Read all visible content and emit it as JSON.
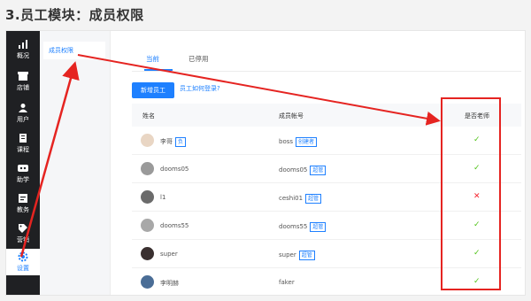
{
  "heading": "3.员工模块：成员权限",
  "rail": [
    {
      "icon": "overview-icon",
      "label": "概况"
    },
    {
      "icon": "store-icon",
      "label": "店铺"
    },
    {
      "icon": "user-icon",
      "label": "用户"
    },
    {
      "icon": "course-icon",
      "label": "课程"
    },
    {
      "icon": "assistant-icon",
      "label": "助学"
    },
    {
      "icon": "academic-icon",
      "label": "教务"
    },
    {
      "icon": "marketing-icon",
      "label": "营销"
    },
    {
      "icon": "settings-icon",
      "label": "设置"
    }
  ],
  "submenu": {
    "item": "成员权限"
  },
  "tabs": [
    "当前",
    "已停用"
  ],
  "toolbar": {
    "add_button": "新增员工",
    "help_link": "员工如何登录?"
  },
  "table": {
    "headers": [
      "姓名",
      "成员帐号",
      "是否老师"
    ],
    "rows": [
      {
        "name": "李哥",
        "name_tag": "负",
        "account": "boss",
        "account_tag": "创建者",
        "is_teacher": "✓"
      },
      {
        "name": "dooms05",
        "name_tag": "",
        "account": "dooms05",
        "account_tag": "超管",
        "is_teacher": "✓"
      },
      {
        "name": "l1",
        "name_tag": "",
        "account": "ceshi01",
        "account_tag": "超管",
        "is_teacher": "✕"
      },
      {
        "name": "dooms55",
        "name_tag": "",
        "account": "dooms55",
        "account_tag": "超管",
        "is_teacher": "✓"
      },
      {
        "name": "super",
        "name_tag": "",
        "account": "super",
        "account_tag": "超管",
        "is_teacher": "✓"
      },
      {
        "name": "李明赫",
        "name_tag": "",
        "account": "faker",
        "account_tag": "",
        "is_teacher": "✓"
      }
    ]
  },
  "colors": {
    "accent": "#1e80ff",
    "annotation": "#e52421",
    "check": "#52c41a",
    "cross": "#f5222d"
  }
}
